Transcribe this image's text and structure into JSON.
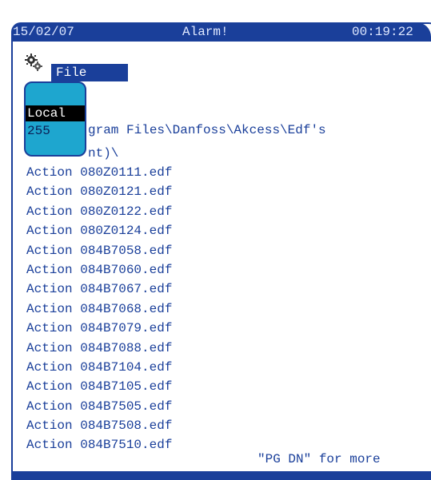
{
  "status_bar": {
    "date": "15/02/07",
    "title": "Alarm!",
    "time": "00:19:22"
  },
  "menu": {
    "gear_icon": "gear-icon",
    "file_label": "File"
  },
  "popup": {
    "items": [
      "Local",
      "255"
    ]
  },
  "path": {
    "line1": "gram Files\\Danfoss\\Akcess\\Edf's",
    "line2": "nt)\\"
  },
  "files": [
    "Action 080Z0111.edf",
    "Action 080Z0121.edf",
    "Action 080Z0122.edf",
    "Action 080Z0124.edf",
    "Action 084B7058.edf",
    "Action 084B7060.edf",
    "Action 084B7067.edf",
    "Action 084B7068.edf",
    "Action 084B7079.edf",
    "Action 084B7088.edf",
    "Action 084B7104.edf",
    "Action 084B7105.edf",
    "Action 084B7505.edf",
    "Action 084B7508.edf",
    "Action 084B7510.edf"
  ],
  "hint": "\"PG DN\" for more",
  "colors": {
    "primary": "#1a3f9a",
    "popup": "#1ea6cf",
    "highlight": "#000000",
    "background": "#ffffff"
  }
}
